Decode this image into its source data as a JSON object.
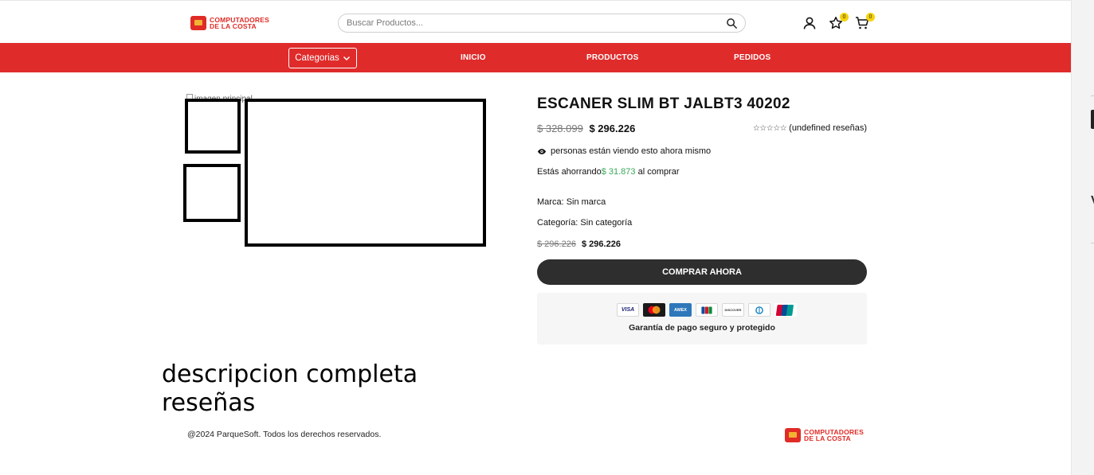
{
  "header": {
    "logo": {
      "line1": "COMPUTADORES",
      "line2": "DE LA COSTA"
    },
    "search": {
      "placeholder": "Buscar Productos..."
    },
    "wishlist_count": "0",
    "cart_count": "0"
  },
  "nav": {
    "categories_label": "Categorias",
    "links": [
      "INICIO",
      "PRODUCTOS",
      "PEDIDOS"
    ]
  },
  "gallery": {
    "broken_image_alt": "imagen principal"
  },
  "product": {
    "title": "ESCANER SLIM BT JALBT3 40202",
    "old_price": "$ 328.099",
    "price": "$ 296.226",
    "stars": "☆☆☆☆☆",
    "reviews_text": "(undefined reseñas)",
    "viewing_text": "personas están viendo esto ahora mismo",
    "saving_prefix": "Estás ahorrando",
    "saving_amount": "$ 31.873",
    "saving_suffix": " al comprar",
    "brand_label": "Marca: ",
    "brand_value": "Sin marca",
    "category_label": "Categoría: ",
    "category_value": "Sin categoría",
    "price2_old": "$ 296.226",
    "price2_new": "$ 296.226",
    "buy_label": "COMPRAR AHORA",
    "payment_cards": [
      "VISA",
      "MASTERCARD",
      "AMEX",
      "JCB",
      "DISCOVER",
      "DINERS",
      "UNIONPAY"
    ],
    "guarantee_text": "Garantía de pago seguro y protegido"
  },
  "sections": {
    "description": "descripcion completa",
    "reviews": "reseñas"
  },
  "footer": {
    "copyright": "@2024 ParqueSoft. Todos los derechos reservados.",
    "logo": {
      "line1": "COMPUTADORES",
      "line2": "DE LA COSTA"
    }
  },
  "side_strip": {
    "letter": "V"
  }
}
